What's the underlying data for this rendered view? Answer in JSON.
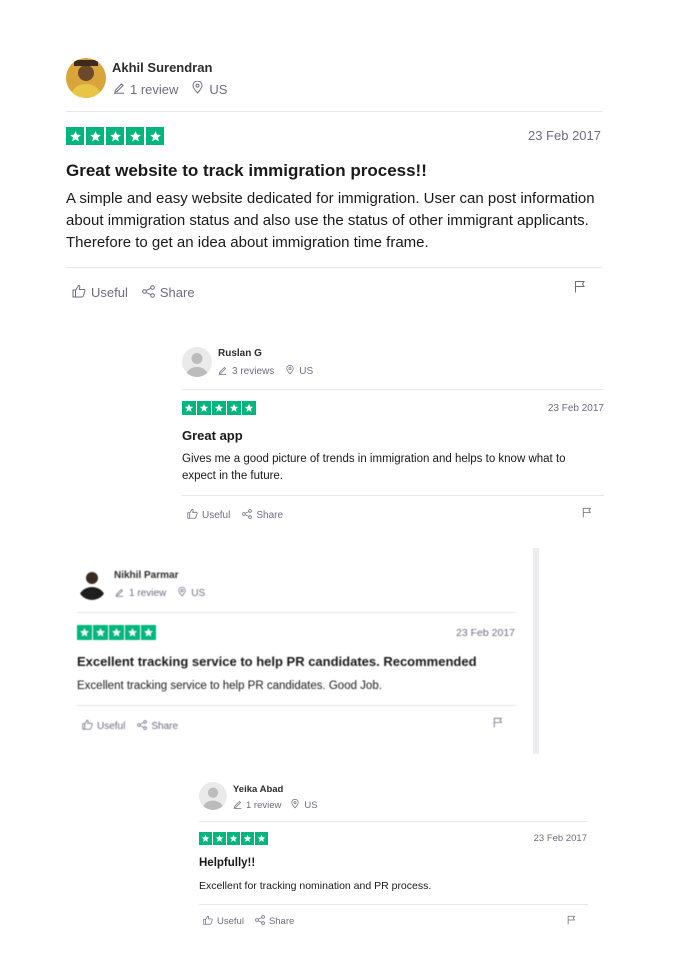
{
  "reviews": [
    {
      "author": "Akhil Surendran",
      "review_count": "1 review",
      "country": "US",
      "rating": 5,
      "date": "23 Feb 2017",
      "title": "Great website to track immigration process!!",
      "body": "A simple and easy website dedicated for immigration. User can post information about immigration status and also use the status of other immigrant applicants. Therefore to get an idea about immigration time frame.",
      "useful_label": "Useful",
      "share_label": "Share"
    },
    {
      "author": "Ruslan G",
      "review_count": "3 reviews",
      "country": "US",
      "rating": 5,
      "date": "23 Feb 2017",
      "title": "Great app",
      "body": "Gives me a good picture of trends in immigration and helps to know what to expect in the future.",
      "useful_label": "Useful",
      "share_label": "Share"
    },
    {
      "author": "Nikhil Parmar",
      "review_count": "1 review",
      "country": "US",
      "rating": 5,
      "date": "23 Feb 2017",
      "title": "Excellent tracking service to help PR candidates. Recommended",
      "body": "Excellent tracking service to help PR candidates. Good Job.",
      "useful_label": "Useful",
      "share_label": "Share"
    },
    {
      "author": "Yeika Abad",
      "review_count": "1 review",
      "country": "US",
      "rating": 5,
      "date": "23 Feb 2017",
      "title": "Helpfully!!",
      "body": "Excellent for tracking nomination and PR process.",
      "useful_label": "Useful",
      "share_label": "Share"
    }
  ],
  "colors": {
    "star_green": "#00b67a",
    "meta_gray": "#6e6c80",
    "divider": "#e6e6e9"
  }
}
